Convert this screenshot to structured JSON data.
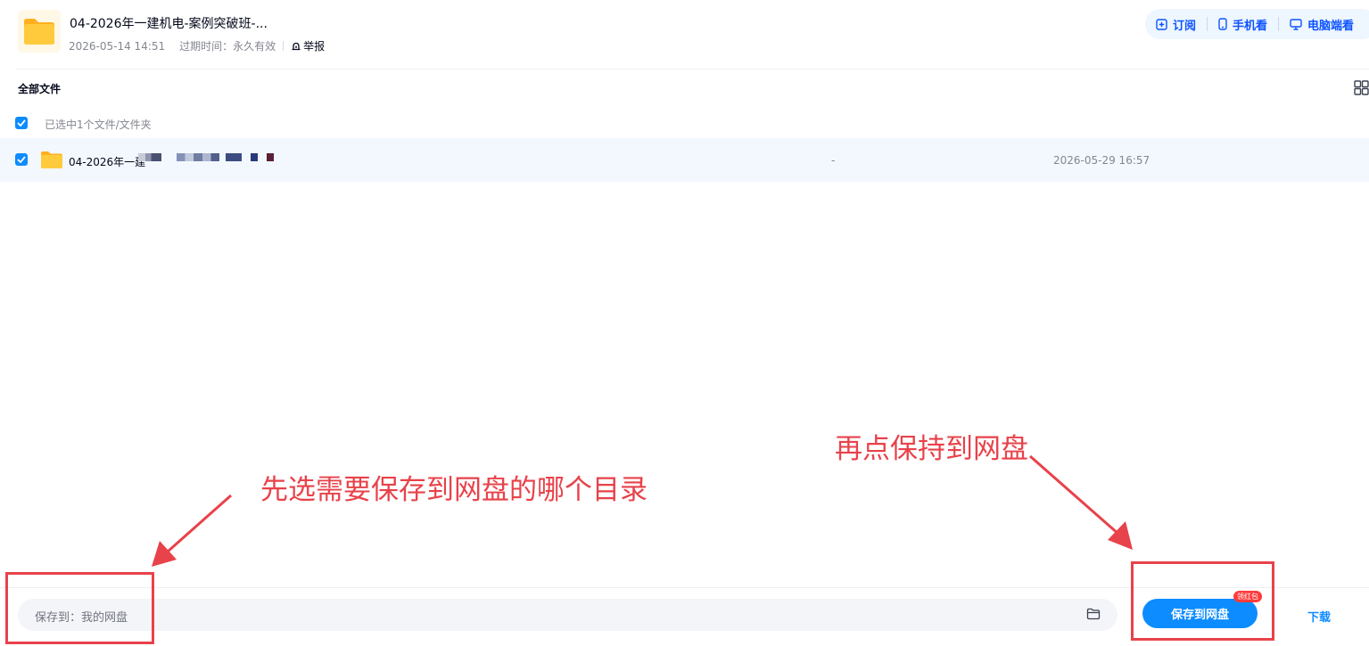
{
  "header": {
    "title": "04-2026年一建机电-案例突破班-...",
    "date": "2026-05-14 14:51",
    "expire_label": "过期时间：永久有效",
    "report_label": "举报"
  },
  "toolbar": {
    "subscribe": "订阅",
    "mobile": "手机看",
    "desktop": "电脑端看"
  },
  "breadcrumb": "全部文件",
  "selection": {
    "count_text": "已选中1个文件/文件夹"
  },
  "files": [
    {
      "name": "04-2026年一建",
      "size": "-",
      "date": "2026-05-29 16:57",
      "checked": true
    }
  ],
  "footer": {
    "save_path_label": "保存到：我的网盘",
    "save_button": "保存到网盘",
    "badge": "领红包",
    "download_button": "下载"
  },
  "annotations": {
    "step1": "先选需要保存到网盘的哪个目录",
    "step2": "再点保持到网盘"
  },
  "colors": {
    "accent": "#0d8cff",
    "toolbar_text": "#0d53ff",
    "annotation": "#e8424a",
    "folder": "#ffc12f"
  }
}
